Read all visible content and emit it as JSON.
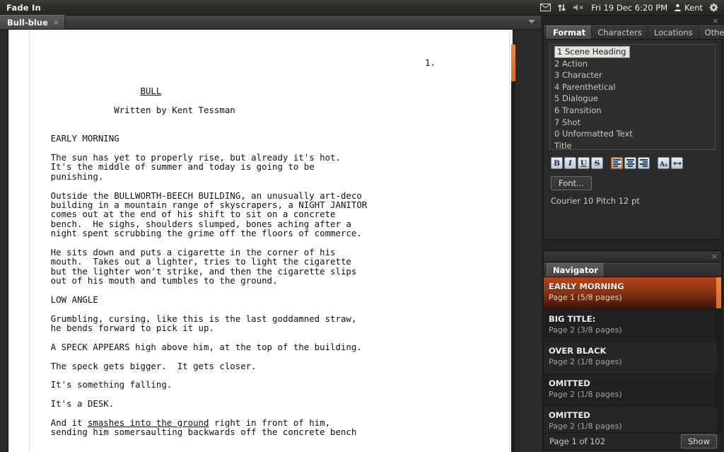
{
  "top_panel": {
    "app_title": "Fade In",
    "tray": {
      "mail_icon": "mail-icon",
      "network_icon": "network-updown-icon",
      "volume_icon": "volume-muted-icon",
      "datetime": "Fri 19 Dec  6:20 PM",
      "user_icon": "user-icon",
      "user_name": "Kent",
      "settings_icon": "gear-icon"
    }
  },
  "document": {
    "tab_label": "Bull-blue",
    "tab_close": "×",
    "page_number_label": "1.",
    "title": "BULL",
    "byline": "Written by Kent Tessman",
    "lines": [
      {
        "type": "blank"
      },
      {
        "type": "blank"
      },
      {
        "type": "blank"
      },
      {
        "type": "pagenum",
        "text": "1."
      },
      {
        "type": "blank"
      },
      {
        "type": "blank"
      },
      {
        "type": "title",
        "text": "                         BULL"
      },
      {
        "type": "blank"
      },
      {
        "type": "byline",
        "text": "                    Written by Kent Tessman"
      },
      {
        "type": "blank"
      },
      {
        "type": "blank"
      },
      {
        "type": "heading",
        "text": "        EARLY MORNING"
      },
      {
        "type": "blank"
      },
      {
        "type": "action",
        "text": "        The sun has yet to properly rise, but already it's hot."
      },
      {
        "type": "action",
        "text": "        It's the middle of summer and today is going to be"
      },
      {
        "type": "action",
        "text": "        punishing."
      },
      {
        "type": "blank"
      },
      {
        "type": "action",
        "text": "        Outside the BULLWORTH-BEECH BUILDING, an unusually art-deco"
      },
      {
        "type": "action",
        "text": "        building in a mountain range of skyscrapers, a NIGHT JANITOR"
      },
      {
        "type": "action",
        "text": "        comes out at the end of his shift to sit on a concrete"
      },
      {
        "type": "action",
        "text": "        bench.  He sighs, shoulders slumped, bones aching after a"
      },
      {
        "type": "action",
        "text": "        night spent scrubbing the grime off the floors of commerce."
      },
      {
        "type": "blank"
      },
      {
        "type": "action",
        "text": "        He sits down and puts a cigarette in the corner of his"
      },
      {
        "type": "action",
        "text": "        mouth.  Takes out a lighter, tries to light the cigarette"
      },
      {
        "type": "action",
        "text": "        but the lighter won't strike, and then the cigarette slips"
      },
      {
        "type": "action",
        "text": "        out of his mouth and tumbles to the ground."
      },
      {
        "type": "blank"
      },
      {
        "type": "heading",
        "text": "        LOW ANGLE"
      },
      {
        "type": "blank"
      },
      {
        "type": "action",
        "text": "        Grumbling, cursing, like this is the last goddamned straw,"
      },
      {
        "type": "action",
        "text": "        he bends forward to pick it up."
      },
      {
        "type": "blank"
      },
      {
        "type": "action",
        "text": "        A SPECK APPEARS high above him, at the top of the building."
      },
      {
        "type": "blank"
      },
      {
        "type": "action",
        "text": "        The speck gets bigger.  It gets closer."
      },
      {
        "type": "blank"
      },
      {
        "type": "action",
        "text": "        It's something falling."
      },
      {
        "type": "blank"
      },
      {
        "type": "action",
        "text": "        It's a DESK."
      },
      {
        "type": "blank"
      },
      {
        "type": "action_underline",
        "pre": "        And it ",
        "mark": "smashes into the ground",
        "post": " right in front of him,"
      },
      {
        "type": "action",
        "text": "        sending him somersaulting backwards off the concrete bench"
      }
    ]
  },
  "format_panel": {
    "close_icon": "×",
    "tabs": [
      {
        "label": "Format",
        "active": true
      },
      {
        "label": "Characters",
        "active": false
      },
      {
        "label": "Locations",
        "active": false
      },
      {
        "label": "Other",
        "active": false
      }
    ],
    "element_list": [
      {
        "label": "1 Scene Heading",
        "selected": true
      },
      {
        "label": "2 Action",
        "selected": false
      },
      {
        "label": "3 Character",
        "selected": false
      },
      {
        "label": "4 Parenthetical",
        "selected": false
      },
      {
        "label": "5 Dialogue",
        "selected": false
      },
      {
        "label": "6 Transition",
        "selected": false
      },
      {
        "label": "7 Shot",
        "selected": false
      },
      {
        "label": "0 Unformatted Text",
        "selected": false
      },
      {
        "label": "Title",
        "selected": false
      }
    ],
    "toolbar": {
      "bold": "B",
      "italic": "I",
      "underline": "U",
      "strikethrough": "S",
      "align_left_icon": "align-left-icon",
      "align_center_icon": "align-center-icon",
      "align_right_icon": "align-right-icon",
      "font_size_icon": "font-size-icon",
      "line_width_icon": "line-width-icon"
    },
    "font_button": "Font...",
    "font_description": "Courier 10 Pitch 12 pt",
    "accent_color": "#d2762c"
  },
  "navigator_panel": {
    "close_icon": "×",
    "tabs": [
      {
        "label": "Navigator",
        "active": true
      }
    ],
    "items": [
      {
        "title": "EARLY MORNING",
        "sub": "Page 1 (5/8 pages)",
        "selected": true
      },
      {
        "title": "BIG TITLE:",
        "sub": "Page 2 (3/8 pages)",
        "selected": false
      },
      {
        "title": "OVER BLACK",
        "sub": "Page 2 (1/8 pages)",
        "selected": false
      },
      {
        "title": "OMITTED",
        "sub": "Page 2 (1/8 pages)",
        "selected": false
      },
      {
        "title": "OMITTED",
        "sub": "Page 2 (1/8 pages)",
        "selected": false
      }
    ],
    "status_text": "Page 1 of 102",
    "show_button": "Show",
    "highlight_color": "#b4441a",
    "scrollbar_color": "#f2853a"
  },
  "window": {
    "close_icon": "×"
  }
}
